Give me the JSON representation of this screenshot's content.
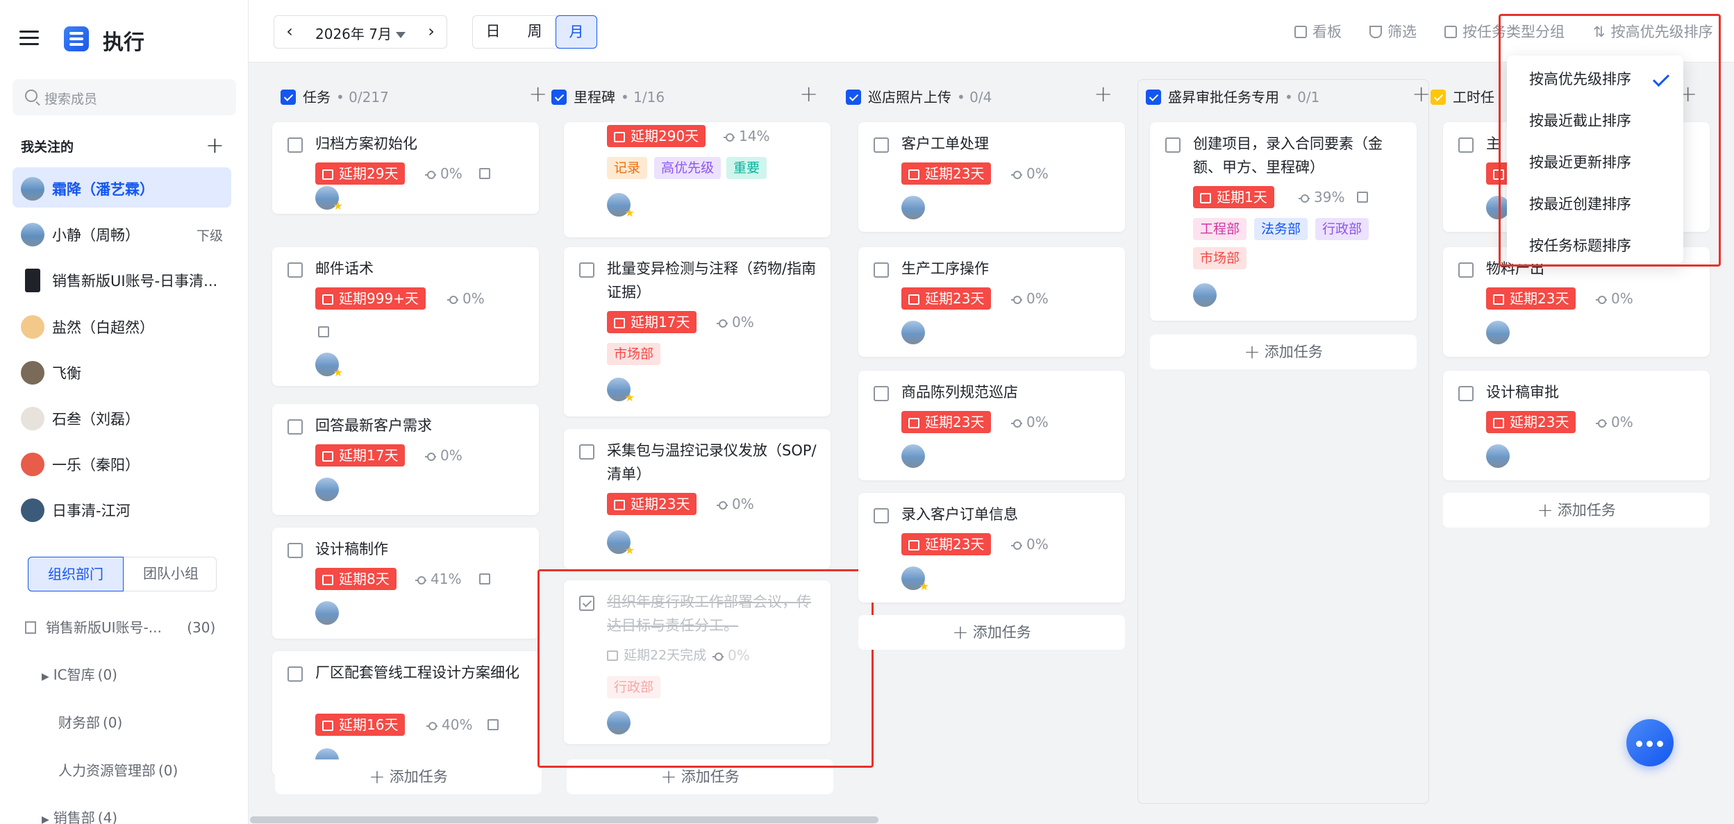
{
  "app": {
    "title": "执行"
  },
  "sidebar": {
    "search_placeholder": "搜索成员",
    "section_title": "我关注的",
    "members": [
      {
        "name": "霜降（潘艺霖）",
        "sub": "",
        "active": true
      },
      {
        "name": "小静（周畅）",
        "sub": "下级",
        "active": false
      },
      {
        "name": "销售新版UI账号-日事清...",
        "sub": "",
        "active": false
      },
      {
        "name": "盐然（白超然）",
        "sub": "",
        "active": false
      },
      {
        "name": "飞衡",
        "sub": "",
        "active": false
      },
      {
        "name": "石叁（刘磊）",
        "sub": "",
        "active": false
      },
      {
        "name": "一乐（秦阳）",
        "sub": "",
        "active": false
      },
      {
        "name": "日事清-江河",
        "sub": "",
        "active": false
      }
    ],
    "tabs": {
      "org": "组织部门",
      "team": "团队小组"
    },
    "depts": [
      {
        "name": "销售新版UI账号-...",
        "count": "(30)"
      },
      {
        "name": "IC智库",
        "count": "(0)"
      },
      {
        "name": "财务部",
        "count": "(0)"
      },
      {
        "name": "人力资源管理部",
        "count": "(0)"
      },
      {
        "name": "销售部",
        "count": "(4)"
      }
    ]
  },
  "topbar": {
    "prev": "‹",
    "month": "2026年 7月",
    "next": "›",
    "views": {
      "day": "日",
      "week": "周",
      "month": "月"
    },
    "kanban": "看板",
    "filter": "筛选",
    "group": "按任务类型分组",
    "sort": "按高优先级排序"
  },
  "sort_menu": [
    "按高优先级排序",
    "按最近截止排序",
    "按最近更新排序",
    "按最近创建排序",
    "按任务标题排序"
  ],
  "columns": [
    {
      "title": "任务",
      "count": "0/217"
    },
    {
      "title": "里程碑",
      "count": "1/16"
    },
    {
      "title": "巡店照片上传",
      "count": "0/4"
    },
    {
      "title": "盛昇审批任务专用",
      "count": "0/1"
    },
    {
      "title": "工时任"
    }
  ],
  "cards": {
    "c1": [
      {
        "title": "归档方案初始化",
        "due": "延期29天",
        "prog": "0%"
      },
      {
        "title": "邮件话术",
        "due": "延期999+天",
        "prog": "0%"
      },
      {
        "title": "回答最新客户需求",
        "due": "延期17天",
        "prog": "0%"
      },
      {
        "title": "设计稿制作",
        "due": "延期8天",
        "prog": "41%"
      },
      {
        "title": "厂区配套管线工程设计方案细化",
        "due": "延期16天",
        "prog": "40%"
      }
    ],
    "c2": [
      {
        "due": "延期290天",
        "prog": "14%",
        "tags": [
          "记录",
          "高优先级",
          "重要"
        ]
      },
      {
        "title": "批量变异检测与注释（药物/指南证据）",
        "due": "延期17天",
        "prog": "0%",
        "tags": [
          "市场部"
        ]
      },
      {
        "title": "采集包与温控记录仪发放（SOP/清单）",
        "due": "延期23天",
        "prog": "0%"
      },
      {
        "title": "组织年度行政工作部署会议，传达目标与责任分工。",
        "due": "延期22天完成",
        "prog": "0%",
        "tags": [
          "行政部"
        ]
      }
    ],
    "c3": [
      {
        "title": "客户工单处理",
        "due": "延期23天",
        "prog": "0%"
      },
      {
        "title": "生产工序操作",
        "due": "延期23天",
        "prog": "0%"
      },
      {
        "title": "商品陈列规范巡店",
        "due": "延期23天",
        "prog": "0%"
      },
      {
        "title": "录入客户订单信息",
        "due": "延期23天",
        "prog": "0%"
      }
    ],
    "c4": [
      {
        "title": "创建项目，录入合同要素（金额、甲方、里程碑）",
        "due": "延期1天",
        "prog": "39%",
        "tags": [
          "工程部",
          "法务部",
          "行政部",
          "市场部"
        ]
      }
    ],
    "c5": [
      {
        "title": "主",
        "due": "延",
        "prog": ""
      },
      {
        "title": "物料产出",
        "due": "延期23天",
        "prog": "0%"
      },
      {
        "title": "设计稿审批",
        "due": "延期23天",
        "prog": "0%"
      }
    ]
  },
  "add_task": "添加任务",
  "colors": {
    "accent": "#1456f0",
    "overdue": "#f54a45",
    "highlight": "#e8322b"
  }
}
